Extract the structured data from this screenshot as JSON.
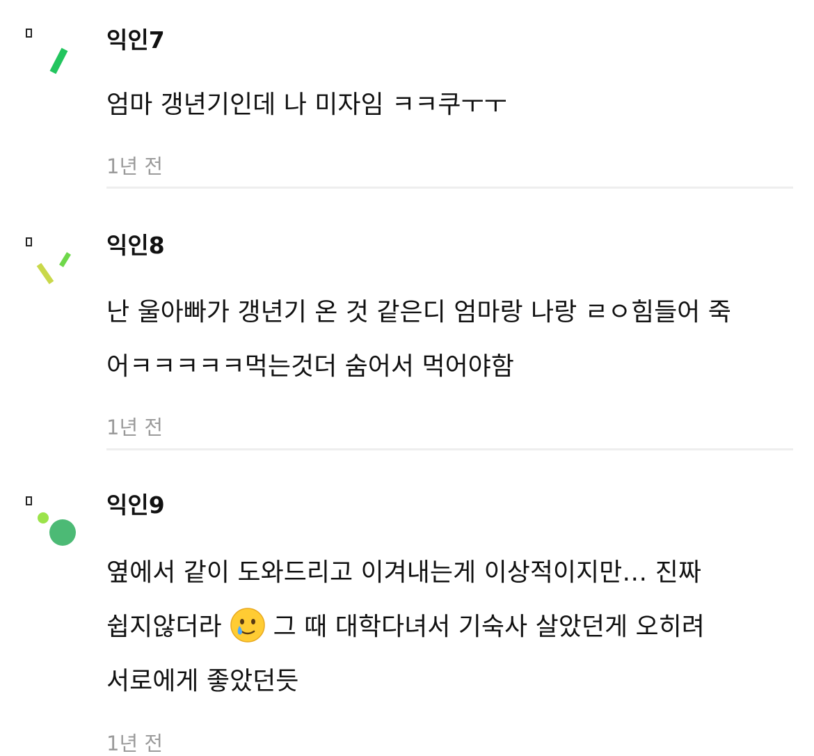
{
  "comments": [
    {
      "user": "익인7",
      "lines": [
        "엄마 갱년기인데 나 미자임 ㅋㅋ쿠ㅜㅜ"
      ],
      "time": "1년 전",
      "avatar_colors": [
        "#2ecc71",
        "#1db954"
      ]
    },
    {
      "user": "익인8",
      "lines": [
        "난 울아빠가 갱년기 온 것 같은디 엄마랑 나랑 ㄹㅇ힘들어 죽",
        "어ㅋㅋㅋㅋㅋ먹는것더 숨어서 먹어야함"
      ],
      "time": "1년 전",
      "avatar_colors": [
        "#c8d84a",
        "#7ed957"
      ]
    },
    {
      "user": "익인9",
      "line1": "옆에서 같이 도와드리고 이겨내는게 이상적이지만… 진짜",
      "line2a": "쉽지않더라",
      "line2b": "그 때 대학다녀서 기숙사 살았던게 오히려",
      "line3": "서로에게 좋았던듯",
      "emoji": "smiling-face-with-tear",
      "time": "1년 전",
      "avatar_colors": [
        "#9be34a",
        "#4cba75"
      ]
    }
  ]
}
